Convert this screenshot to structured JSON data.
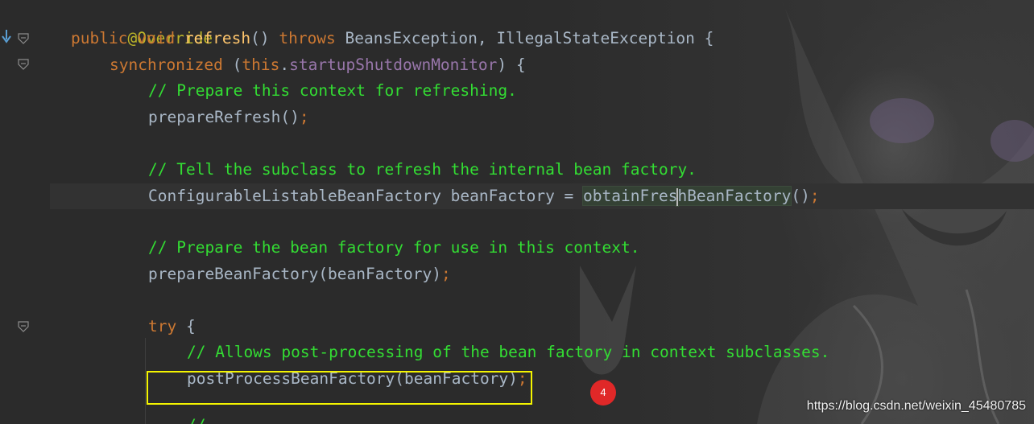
{
  "editor": {
    "lines": [
      {
        "id": "l1",
        "text_annotation": "@Override"
      },
      {
        "id": "l2"
      },
      {
        "id": "l3"
      },
      {
        "id": "l4"
      },
      {
        "id": "l5"
      },
      {
        "id": "l6"
      },
      {
        "id": "l7"
      },
      {
        "id": "l8"
      },
      {
        "id": "l9"
      },
      {
        "id": "l10"
      },
      {
        "id": "l11"
      },
      {
        "id": "l12"
      },
      {
        "id": "l13"
      }
    ],
    "tokens": {
      "annotation": "@Override",
      "public": "public",
      "void": "void",
      "refresh": "refresh",
      "refresh_parens": "() ",
      "throws": "throws",
      "exceptions": " BeansException, IllegalStateException {",
      "synchronized": "synchronized",
      "sync_open": " (",
      "this": "this",
      "dot": ".",
      "monitor": "startupShutdownMonitor",
      "sync_close": ") {",
      "c1": "// Prepare this context for refreshing.",
      "prepareRefresh": "prepareRefresh()",
      "semi": ";",
      "c2": "// Tell the subclass to refresh the internal bean factory.",
      "cfg_decl": "ConfigurableListableBeanFactory beanFactory = ",
      "obtain_a": "obtainFres",
      "obtain_b": "hBeanFactory",
      "obtain_parens": "()",
      "c3": "// Prepare the bean factory for use in this context.",
      "prepareBeanFactory": "prepareBeanFactory(beanFactory)",
      "try": "try",
      "try_brace": " {",
      "c4": "// Allows post-processing of the bean factory in context subclasses.",
      "postProcess": "postProcessBeanFactory(beanFactory)",
      "next_cmt": "//"
    }
  },
  "annotations": {
    "step_badge": "4"
  },
  "watermark": "https://blog.csdn.net/weixin_45480785",
  "colors": {
    "background": "#2b2b2b",
    "comment": "#33dd33",
    "keyword": "#cc7832",
    "method_decl": "#ffc66d",
    "field": "#9876aa",
    "default_text": "#a9b7c6",
    "highlight_box": "#f4f400",
    "badge": "#e02828"
  }
}
